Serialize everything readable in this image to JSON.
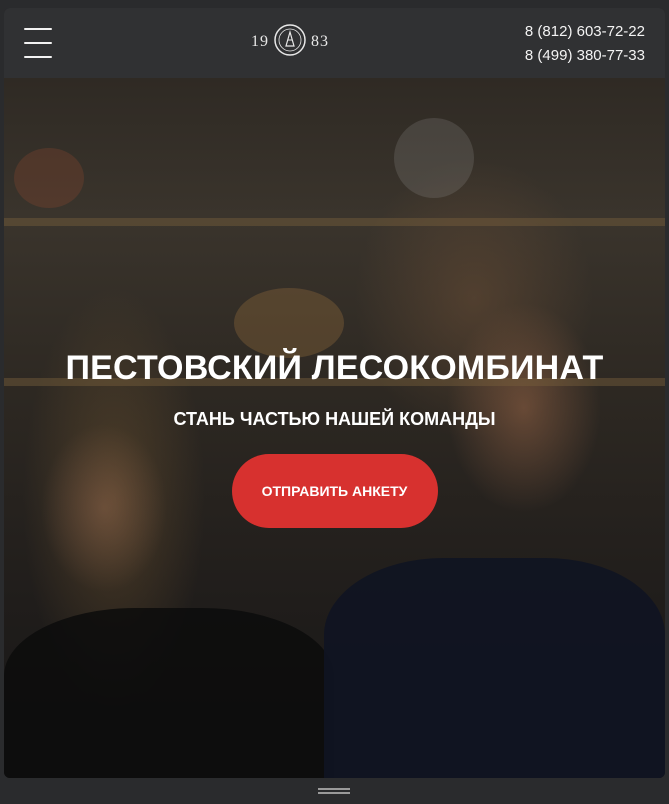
{
  "header": {
    "menu_icon": "hamburger-menu-icon",
    "logo": {
      "year_left": "19",
      "year_right": "83",
      "emblem_icon": "company-seal-icon"
    },
    "phones": [
      "8 (812) 603-72-22",
      "8 (499) 380-77-33"
    ]
  },
  "hero": {
    "title": "ПЕСТОВСКИЙ ЛЕСОКОМБИНАТ",
    "subtitle": "СТАНЬ ЧАСТЬЮ НАШЕЙ КОМАНДЫ",
    "cta_label": "ОТПРАВИТЬ АНКЕТУ",
    "background_icon": "hero-photo-two-people-smiling"
  },
  "colors": {
    "header_bg": "#303133",
    "cta_bg": "#d7312f",
    "text": "#ffffff"
  }
}
